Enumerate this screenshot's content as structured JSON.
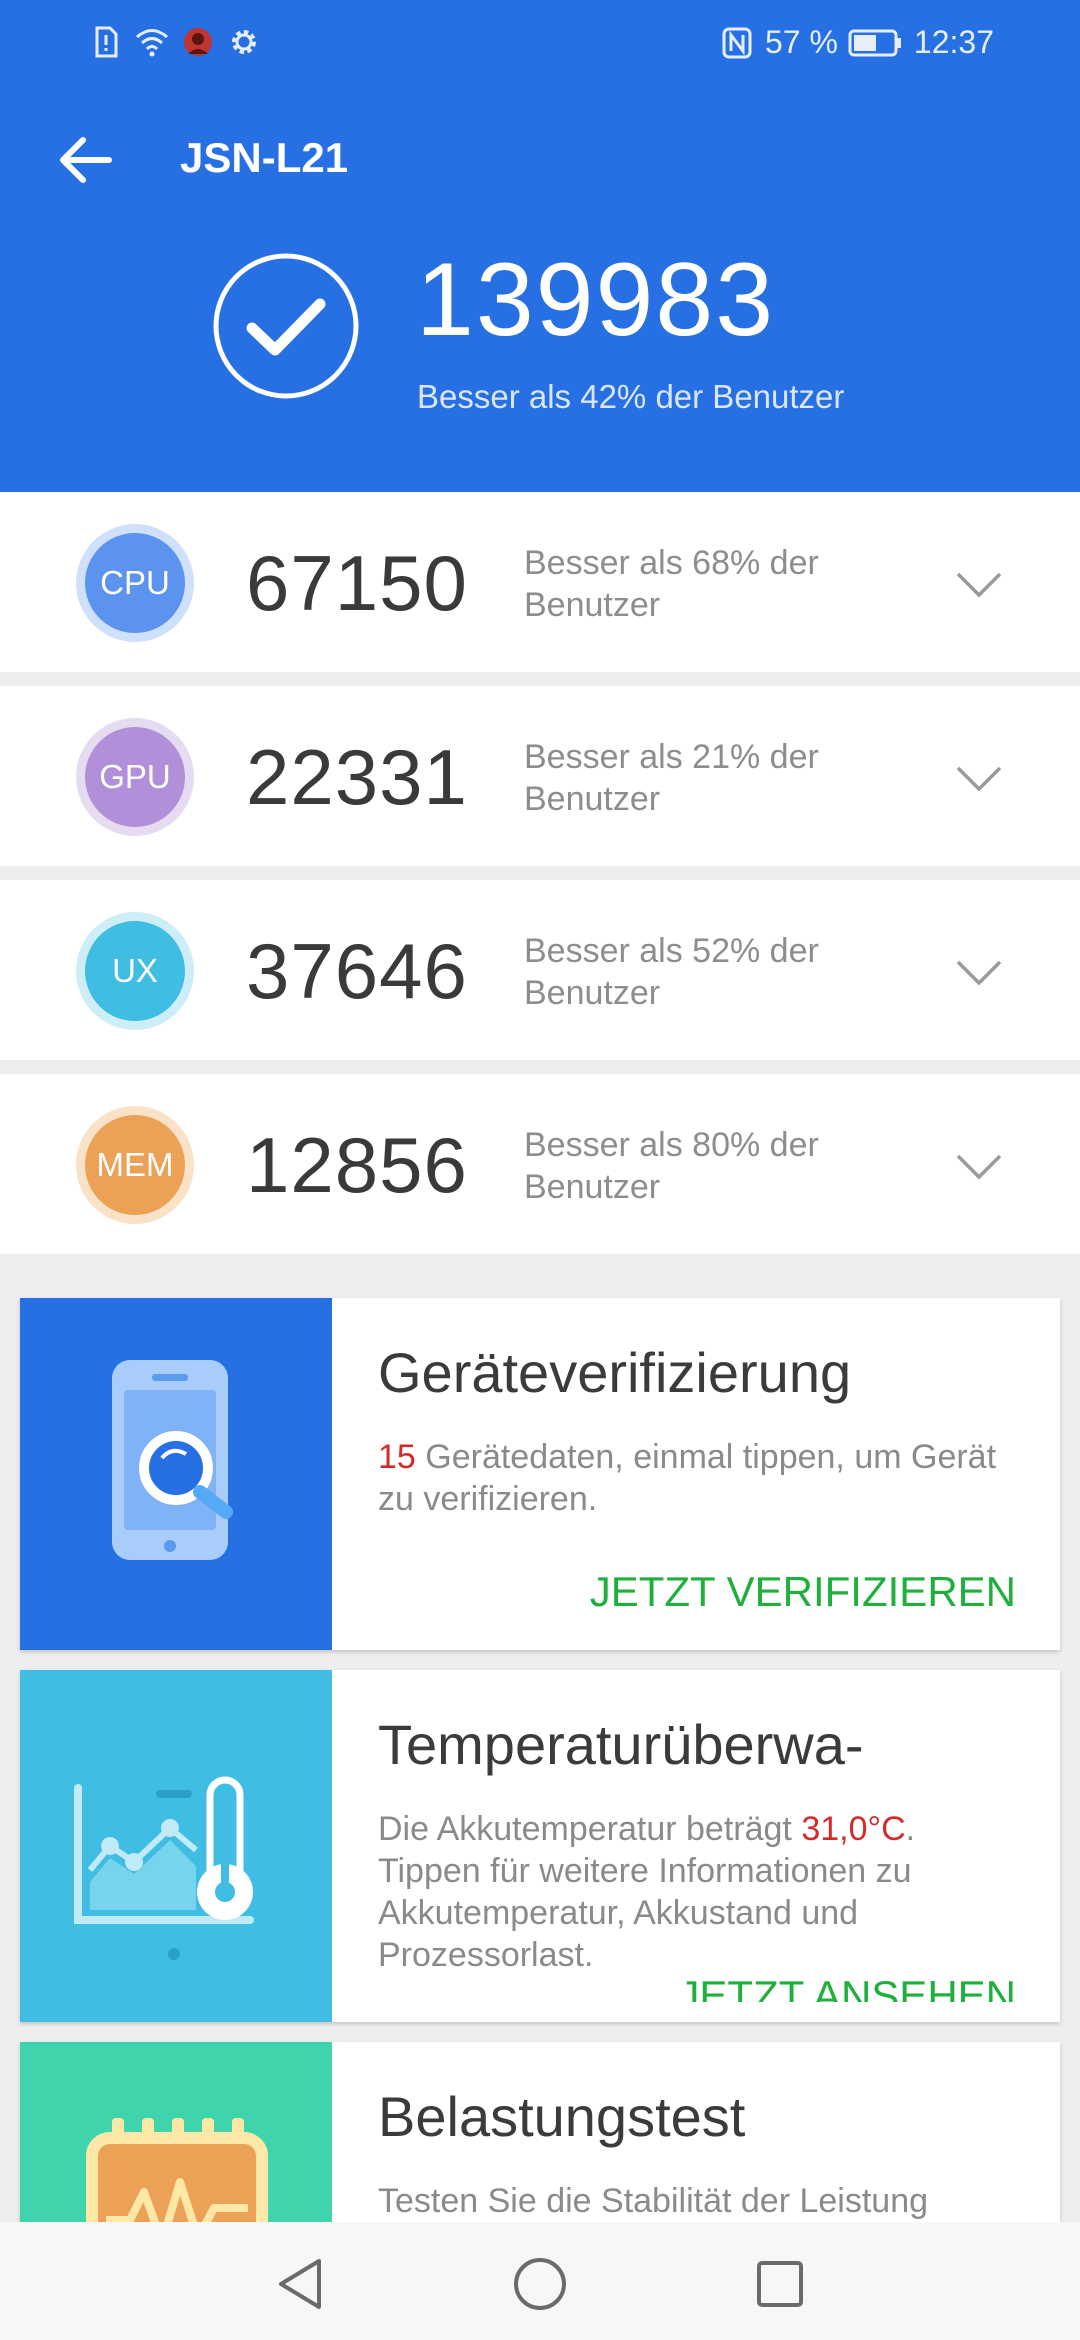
{
  "status_bar": {
    "battery": "57 %",
    "time": "12:37",
    "left_icons": [
      "sim-alert-icon",
      "wifi-icon",
      "app-notification-icon",
      "gear-icon"
    ],
    "right_icons": [
      "nfc-icon",
      "battery-icon"
    ]
  },
  "header": {
    "title": "JSN-L21",
    "total_score": "139983",
    "total_desc": "Besser als 42% der Benutzer",
    "color": "#2770e3"
  },
  "scores": [
    {
      "badge": "CPU",
      "score": "67150",
      "desc": "Besser als 68% der Benutzer",
      "color": "#5b93ef",
      "ring": "#cfe0fb"
    },
    {
      "badge": "GPU",
      "score": "22331",
      "desc": "Besser als 21% der Benutzer",
      "color": "#b190d9",
      "ring": "#e6dcf2"
    },
    {
      "badge": "UX",
      "score": "37646",
      "desc": "Besser als 52% der Benutzer",
      "color": "#3fbde2",
      "ring": "#cdeef7"
    },
    {
      "badge": "MEM",
      "score": "12856",
      "desc": "Besser als 80% der Benutzer",
      "color": "#eba257",
      "ring": "#fae2c9"
    }
  ],
  "cards": {
    "verify": {
      "title": "Geräteverifizierung",
      "count": "15",
      "text": " Gerätedaten, einmal tippen, um Gerät zu verifizieren.",
      "action": "JETZT VERIFIZIEREN",
      "color": "#2770e3"
    },
    "temperature": {
      "title": "Temperaturüberwa-",
      "text_before": "Die Akkutemperatur beträgt ",
      "temp": "31,0°C",
      "text_after": ". Tippen für weitere Informationen zu Akkutemperatur, Akkustand und Prozessorlast.",
      "action": "JETZT ANSEHEN",
      "color": "#3fbde2"
    },
    "stress": {
      "title": "Belastungstest",
      "text": "Testen Sie die Stabilität der Leistung",
      "color": "#3fd4ac"
    }
  },
  "nav": {
    "icons": [
      "back-triangle-icon",
      "home-circle-icon",
      "recents-square-icon"
    ]
  }
}
